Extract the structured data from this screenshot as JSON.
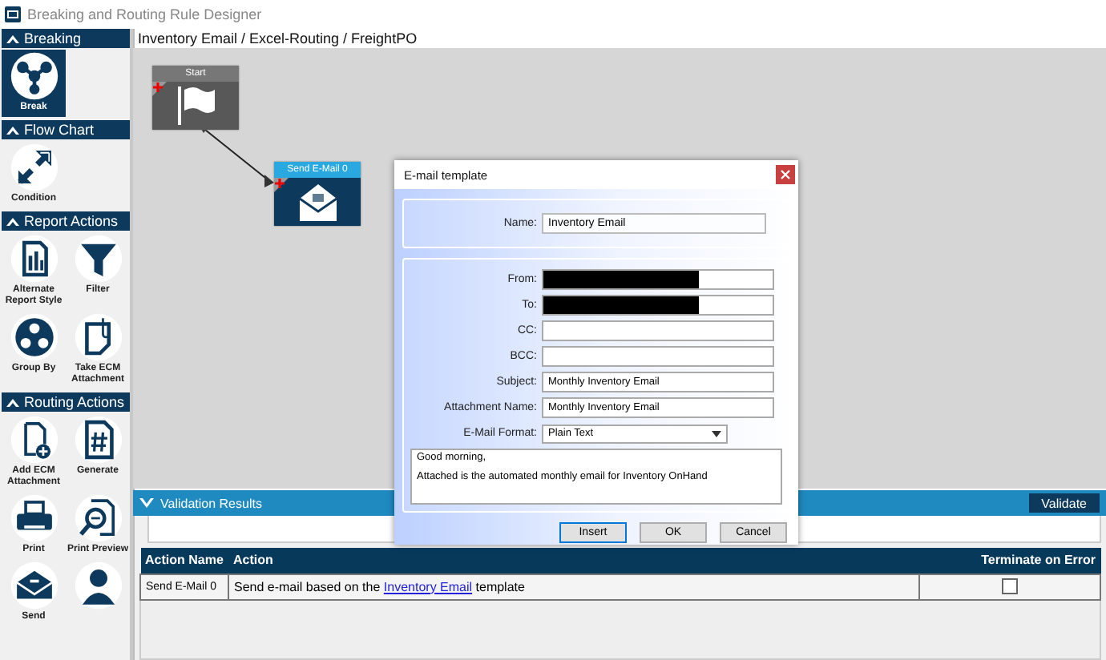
{
  "window": {
    "title": "Breaking and Routing Rule Designer"
  },
  "sidebar": {
    "sections": [
      {
        "title": "Breaking",
        "expanded": true,
        "items": [
          {
            "label": "Break",
            "selected": true
          }
        ]
      },
      {
        "title": "Flow Chart",
        "expanded": true,
        "items": [
          {
            "label": "Condition",
            "selected": false
          }
        ]
      },
      {
        "title": "Report Actions",
        "expanded": true,
        "items": [
          {
            "label": "Alternate Report Style",
            "selected": false
          },
          {
            "label": "Filter",
            "selected": false
          },
          {
            "label": "Group By",
            "selected": false
          },
          {
            "label": "Take ECM Attachment",
            "selected": false
          }
        ]
      },
      {
        "title": "Routing Actions",
        "expanded": true,
        "items": [
          {
            "label": "Add ECM Attachment",
            "selected": false
          },
          {
            "label": "Generate",
            "selected": false
          },
          {
            "label": "Print",
            "selected": false
          },
          {
            "label": "Print Preview",
            "selected": false
          },
          {
            "label": "Send",
            "selected": false
          },
          {
            "selected": false
          }
        ]
      }
    ]
  },
  "breadcrumb": "Inventory Email / Excel-Routing / FreightPO",
  "canvas": {
    "nodes": [
      {
        "title": "Start",
        "kind": "start"
      },
      {
        "title": "Send E-Mail 0",
        "kind": "email"
      }
    ]
  },
  "validation": {
    "title": "Validation Results",
    "expanded": true,
    "button": "Validate",
    "table": {
      "columns": [
        "Action Name",
        "Action",
        "Terminate on Error"
      ],
      "rows": [
        {
          "action_name": "Send E-Mail 0",
          "action_before": "Send e-mail based on the ",
          "action_link": "Inventory Email",
          "action_after": " template",
          "terminate_on_error": false
        }
      ]
    }
  },
  "dialog": {
    "title": "E-mail template",
    "name_label": "Name:",
    "name_value": "Inventory Email",
    "fields": [
      {
        "label": "From:",
        "redacted": true
      },
      {
        "label": "To:",
        "redacted": true
      },
      {
        "label": "CC:",
        "redacted": false
      },
      {
        "label": "BCC:",
        "redacted": false
      },
      {
        "label": "Subject:",
        "value": "Monthly Inventory Email",
        "redacted": false
      },
      {
        "label": "Attachment Name:",
        "value": "Monthly Inventory Email",
        "redacted": false
      }
    ],
    "format_label": "E-Mail Format:",
    "format_value": "Plain Text",
    "body": [
      "Good morning,",
      "Attached is the automated monthly email for Inventory OnHand"
    ],
    "buttons": [
      {
        "label": "Insert",
        "focused": true
      },
      {
        "label": "OK",
        "focused": false
      },
      {
        "label": "Cancel",
        "focused": false
      }
    ]
  }
}
